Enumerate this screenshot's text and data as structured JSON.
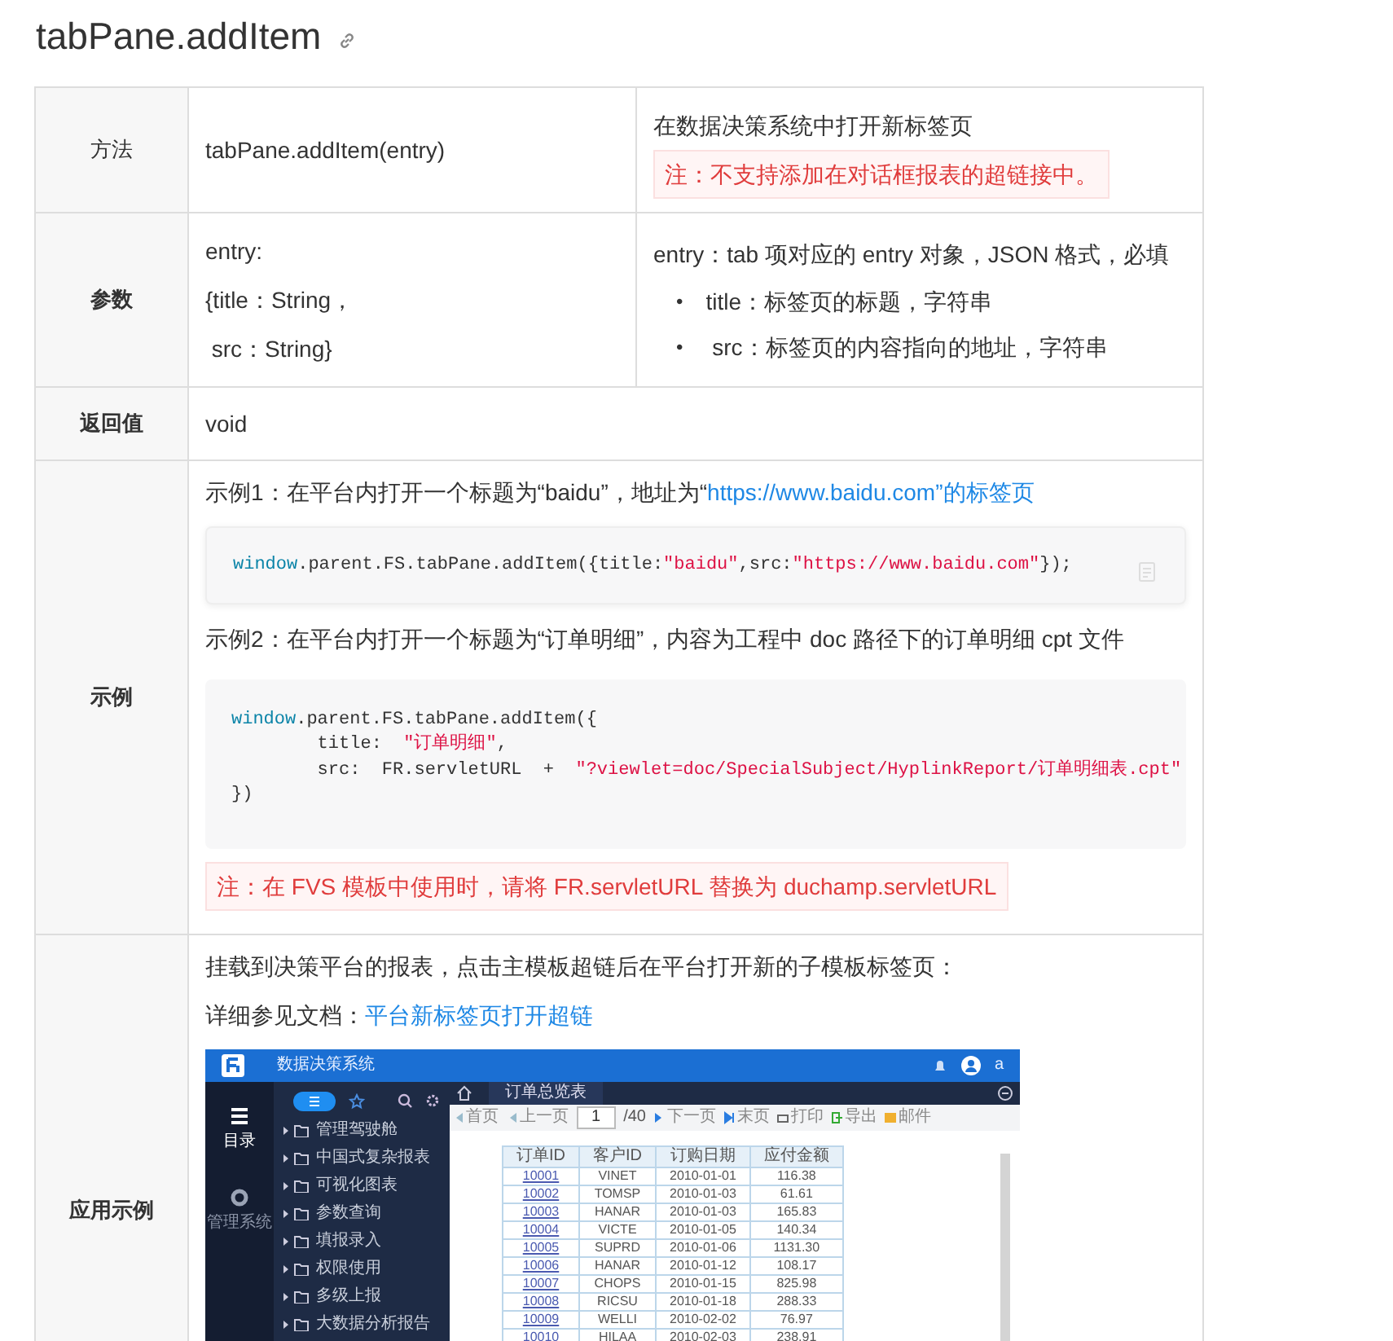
{
  "title": "tabPane.addItem",
  "method": {
    "label": "方法",
    "signature": "tabPane.addItem(entry)",
    "description": "在数据决策系统中打开新标签页",
    "note": "注：不支持添加在对话框报表的超链接中。"
  },
  "params": {
    "label": "参数",
    "lines": [
      "entry:",
      "{title：String，",
      " src：String}"
    ],
    "description": "entry：tab 项对应的 entry 对象，JSON 格式，必填",
    "marker": "•",
    "bullets": [
      "title：标签页的标题，字符串",
      " src：标签页的内容指向的地址，字符串"
    ]
  },
  "returns": {
    "label": "返回值",
    "value": "void"
  },
  "example": {
    "label": "示例",
    "blocks": [
      {
        "kind": "text",
        "text": "示例1：在平台内打开一个标题为“baidu”，地址为“",
        "link": "https://www.baidu.com”的标签页"
      },
      {
        "kind": "code",
        "boxed": true,
        "lines": [
          [
            {
              "kind": "keyword",
              "text": "window"
            },
            {
              "kind": "plain",
              "text": ".parent.FS.tabPane.addItem({title:"
            },
            {
              "kind": "string",
              "text": "\"baidu\""
            },
            {
              "kind": "plain",
              "text": ",src:"
            },
            {
              "kind": "string",
              "text": "\"https://www.baidu.com\""
            },
            {
              "kind": "plain",
              "text": "});"
            }
          ]
        ]
      },
      {
        "kind": "text",
        "text": "示例2：在平台内打开一个标题为“订单明细”，内容为工程中 doc 路径下的订单明细 cpt 文件"
      },
      {
        "kind": "code",
        "boxed": false,
        "lines": [
          [
            {
              "kind": "keyword",
              "text": "window"
            },
            {
              "kind": "plain",
              "text": ".parent.FS.tabPane.addItem({"
            }
          ],
          [
            {
              "kind": "plain",
              "text": "        title:  "
            },
            {
              "kind": "string",
              "text": "\"订单明细\""
            },
            {
              "kind": "plain",
              "text": ","
            }
          ],
          [
            {
              "kind": "plain",
              "text": "        src:  FR.servletURL  +  "
            },
            {
              "kind": "string",
              "text": "\"?viewlet=doc/SpecialSubject/HyplinkReport/订单明细表.cpt\""
            }
          ],
          [
            {
              "kind": "plain",
              "text": "})"
            }
          ]
        ]
      },
      {
        "kind": "note",
        "text": "注：在 FVS 模板中使用时，请将 FR.servletURL 替换为 duchamp.servletURL"
      }
    ]
  },
  "application": {
    "label": "应用示例",
    "text": "挂载到决策平台的报表，点击主模板超链后在平台打开新的子模板标签页：",
    "doc_prefix": "详细参见文档：",
    "doc_link": "平台新标签页打开超链",
    "screenshot": {
      "app_title": "数据决策系统",
      "user": "a",
      "rail": [
        "目录",
        "管理系统"
      ],
      "sidebar": [
        "管理驾驶舱",
        "中国式复杂报表",
        "可视化图表",
        "参数查询",
        "填报录入",
        "权限使用",
        "多级上报",
        "大数据分析报告"
      ],
      "tab": "订单总览表",
      "toolbar": {
        "first": "首页",
        "prev": "上一页",
        "page": "1",
        "total": "/40",
        "next": "下一页",
        "last": "末页",
        "print": "打印",
        "export": "导出",
        "mail": "邮件"
      },
      "columns": [
        "订单ID",
        "客户ID",
        "订购日期",
        "应付金额"
      ],
      "rows": [
        [
          "10001",
          "VINET",
          "2010-01-01",
          "116.38"
        ],
        [
          "10002",
          "TOMSP",
          "2010-01-03",
          "61.61"
        ],
        [
          "10003",
          "HANAR",
          "2010-01-03",
          "165.83"
        ],
        [
          "10004",
          "VICTE",
          "2010-01-05",
          "140.34"
        ],
        [
          "10005",
          "SUPRD",
          "2010-01-06",
          "1131.30"
        ],
        [
          "10006",
          "HANAR",
          "2010-01-12",
          "108.17"
        ],
        [
          "10007",
          "CHOPS",
          "2010-01-15",
          "825.98"
        ],
        [
          "10008",
          "RICSU",
          "2010-01-18",
          "288.33"
        ],
        [
          "10009",
          "WELLI",
          "2010-02-02",
          "76.97"
        ],
        [
          "10010",
          "HILAA",
          "2010-02-03",
          "238.91"
        ]
      ]
    }
  }
}
